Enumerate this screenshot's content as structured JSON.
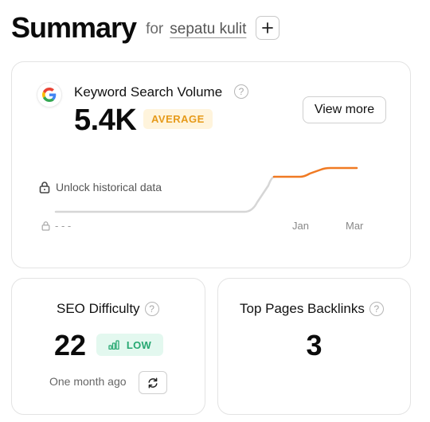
{
  "header": {
    "title": "Summary",
    "for_label": "for",
    "keyword": "sepatu kulit",
    "add_icon": "plus-icon"
  },
  "keyword_volume": {
    "source_icon": "google-icon",
    "label": "Keyword Search Volume",
    "value": "5.4K",
    "badge": "AVERAGE",
    "view_more": "View more",
    "unlock_text": "Unlock historical data",
    "locked_axis_label": "- - -",
    "ticks": [
      "Jan",
      "Mar"
    ],
    "colors": {
      "trend": "#f07a23",
      "locked_trend": "#d6d6d6"
    }
  },
  "seo_difficulty": {
    "label": "SEO Difficulty",
    "value": "22",
    "badge": "LOW",
    "badge_icon": "bar-chart-icon",
    "updated": "One month ago",
    "refresh_icon": "refresh-icon"
  },
  "top_pages_backlinks": {
    "label": "Top Pages Backlinks",
    "value": "3"
  }
}
